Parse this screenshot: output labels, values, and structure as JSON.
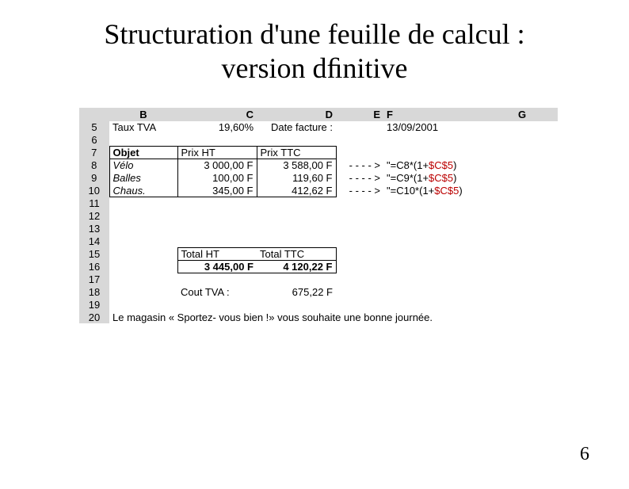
{
  "title_line1": "Structuration d'une feuille de calcul :",
  "title_line2": "version dﬁnitive",
  "page_number": "6",
  "col_headers": {
    "B": "B",
    "C": "C",
    "D": "D",
    "E": "E",
    "F": "F",
    "G": "G"
  },
  "rows": {
    "5": {
      "num": "5",
      "B": "Taux TVA",
      "C": "19,60%",
      "D": "Date facture :",
      "E": "",
      "F": "13/09/2001",
      "G": ""
    },
    "6": {
      "num": "6"
    },
    "7": {
      "num": "7",
      "B": "Objet",
      "C": "Prix HT",
      "D": "Prix TTC"
    },
    "8": {
      "num": "8",
      "B": "Vélo",
      "C": "3 000,00 F",
      "D": "3 588,00 F",
      "E": "- - - - >",
      "F_pre": "\"=C8*(1+",
      "F_ref": "$C$5",
      "F_post": ")"
    },
    "9": {
      "num": "9",
      "B": "Balles",
      "C": "100,00 F",
      "D": "119,60 F",
      "E": "- - - - >",
      "F_pre": "\"=C9*(1+",
      "F_ref": "$C$5",
      "F_post": ")"
    },
    "10": {
      "num": "10",
      "B": "Chaus.",
      "C": "345,00 F",
      "D": "412,62 F",
      "E": "- - - - >",
      "F_pre": "\"=C10*(1+",
      "F_ref": "$C$5",
      "F_post": ")"
    },
    "11": {
      "num": "11"
    },
    "12": {
      "num": "12"
    },
    "13": {
      "num": "13"
    },
    "14": {
      "num": "14"
    },
    "15": {
      "num": "15",
      "C": "Total HT",
      "D": "Total TTC"
    },
    "16": {
      "num": "16",
      "C": "3 445,00 F",
      "D": "4 120,22 F"
    },
    "17": {
      "num": "17"
    },
    "18": {
      "num": "18",
      "B": "",
      "C": "Cout TVA :",
      "D": "675,22 F"
    },
    "19": {
      "num": "19"
    },
    "20": {
      "num": "20",
      "msg": "Le magasin « Sportez- vous bien !» vous souhaite une bonne journée."
    }
  }
}
